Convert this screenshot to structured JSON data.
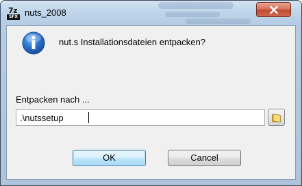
{
  "window": {
    "title": "nuts_2008",
    "icon_top": "7z",
    "icon_bottom": "SFX",
    "accent_color": "#c24a32"
  },
  "dialog": {
    "message": "nut.s Installationsdateien entpacken?",
    "extract_label": "Entpacken nach ...",
    "path_value": ".\\nutssetup",
    "ok_label": "OK",
    "cancel_label": "Cancel"
  },
  "icons": {
    "app": "7zip-sfx-icon",
    "info": "info-icon",
    "close": "close-icon",
    "browse": "folder-icon"
  }
}
